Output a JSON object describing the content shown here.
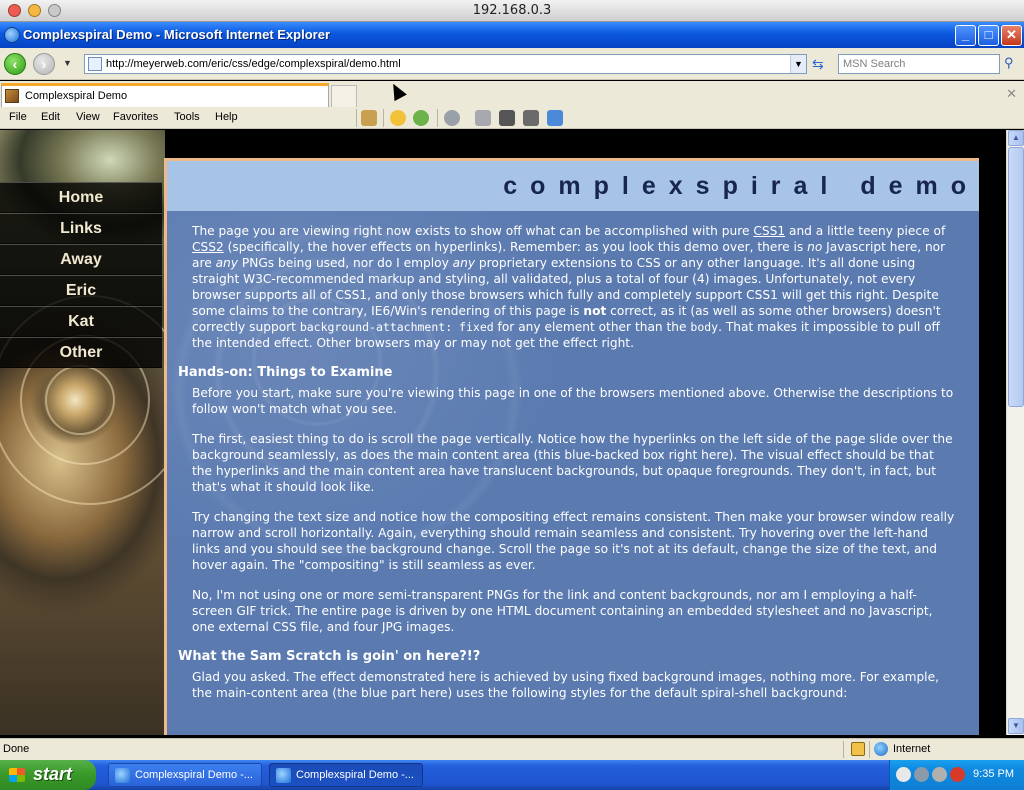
{
  "mac_window": {
    "title": "192.168.0.3"
  },
  "ie_window": {
    "title": "Complexspiral Demo - Microsoft Internet Explorer",
    "buttons": {
      "minimize": "_",
      "maximize": "□",
      "close": "✕"
    }
  },
  "address_bar": {
    "url": "http://meyerweb.com/eric/css/edge/complexspiral/demo.html",
    "search_placeholder": "MSN Search"
  },
  "tabs": [
    {
      "label": "Complexspiral Demo"
    }
  ],
  "menu": [
    "File",
    "Edit",
    "View",
    "Favorites",
    "Tools",
    "Help"
  ],
  "sidebar": {
    "links": [
      "Home",
      "Links",
      "Away",
      "Eric",
      "Kat",
      "Other"
    ]
  },
  "content": {
    "heading": "complexspiral demo",
    "intro_parts": {
      "a": "The page you are viewing right now exists to show off what can be accomplished with pure ",
      "link1": "CSS1",
      "b": " and a little teeny piece of ",
      "link2": "CSS2",
      "c": " (specifically, the hover effects on hyperlinks). Remember: as you look this demo over, there is ",
      "em1": "no",
      "d": " Javascript here, nor are ",
      "em2": "any",
      "e": " PNGs being used, nor do I employ ",
      "em3": "any",
      "f": " proprietary extensions to CSS or any other language. It's all done using straight W3C-recommended markup and styling, all validated, plus a total of four (4) images. Unfortunately, not every browser supports all of CSS1, and only those browsers which fully and completely support CSS1 will get this right. Despite some claims to the contrary, IE6/Win's rendering of this page is ",
      "strong1": "not",
      "g": " correct, as it (as well as some other browsers) doesn't correctly support ",
      "code1": "background-attachment: fixed",
      "h": " for any element other than the ",
      "code2": "body",
      "i": ". That makes it impossible to pull off the intended effect. Other browsers may or may not get the effect right."
    },
    "section1_title": "Hands-on: Things to Examine",
    "section1_paras": [
      "Before you start, make sure you're viewing this page in one of the browsers mentioned above. Otherwise the descriptions to follow won't match what you see.",
      "The first, easiest thing to do is scroll the page vertically. Notice how the hyperlinks on the left side of the page slide over the background seamlessly, as does the main content area (this blue-backed box right here). The visual effect should be that the hyperlinks and the main content area have translucent backgrounds, but opaque foregrounds. They don't, in fact, but that's what it should look like.",
      "Try changing the text size and notice how the compositing effect remains consistent. Then make your browser window really narrow and scroll horizontally. Again, everything should remain seamless and consistent. Try hovering over the left-hand links and you should see the background change. Scroll the page so it's not at its default, change the size of the text, and hover again. The \"compositing\" is still seamless as ever.",
      "No, I'm not using one or more semi-transparent PNGs for the link and content backgrounds, nor am I employing a half-screen GIF trick. The entire page is driven by one HTML document containing an embedded stylesheet and no Javascript, one external CSS file, and four JPG images."
    ],
    "section2_title": "What the Sam Scratch is goin' on here?!?",
    "section2_paras": [
      "Glad you asked. The effect demonstrated here is achieved by using fixed background images, nothing more. For example, the main-content area (the blue part here) uses the following styles for the default spiral-shell background:"
    ]
  },
  "status_bar": {
    "message": "Done",
    "zone": "Internet"
  },
  "taskbar": {
    "start_label": "start",
    "tasks": [
      "Complexspiral Demo -...",
      "Complexspiral Demo -..."
    ],
    "clock": "9:35 PM"
  }
}
